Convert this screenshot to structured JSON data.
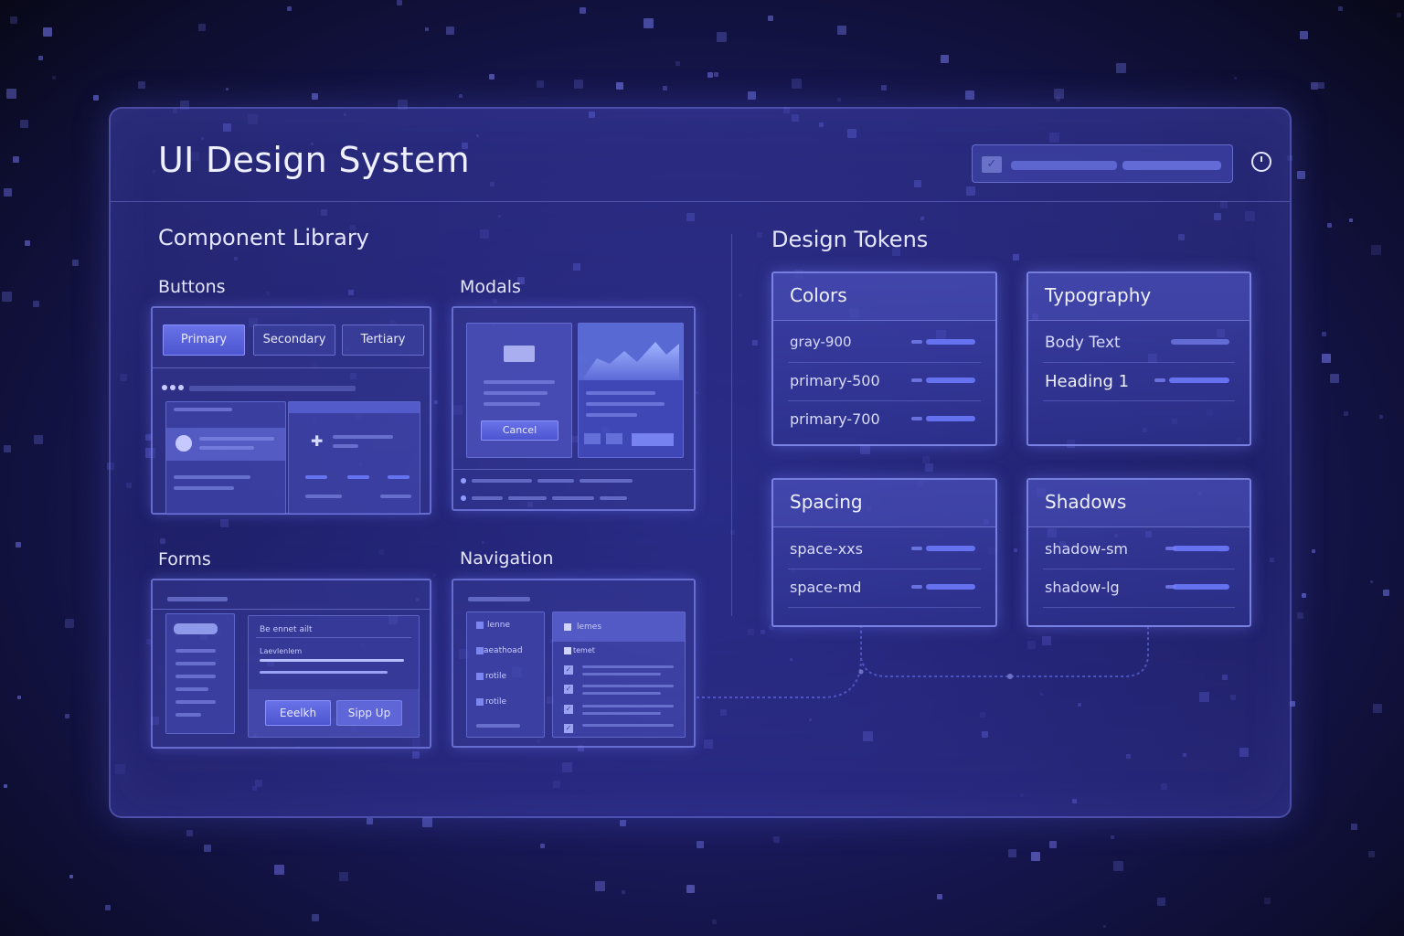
{
  "header": {
    "title": "UI Design System"
  },
  "component_library": {
    "title": "Component Library",
    "buttons": {
      "title": "Buttons",
      "labels": [
        "Primary",
        "Secondary",
        "Tertiary"
      ]
    },
    "modals": {
      "title": "Modals",
      "cancel_label": "Cancel"
    },
    "forms": {
      "title": "Forms",
      "field_label_1": "Be ennet ailt",
      "field_label_2": "Laevlenlem",
      "button_1": "Eeelkh",
      "button_2": "Sipp Up"
    },
    "navigation": {
      "title": "Navigation",
      "side_items": [
        "lenne",
        "aeathoad",
        "rotile",
        "rotile"
      ],
      "panel_header": "lemes",
      "panel_subheader": "temet"
    }
  },
  "design_tokens": {
    "title": "Design Tokens",
    "colors": {
      "title": "Colors",
      "items": [
        "gray-900",
        "primary-500",
        "primary-700"
      ]
    },
    "typography": {
      "title": "Typography",
      "items": [
        "Body Text",
        "Heading 1"
      ]
    },
    "spacing": {
      "title": "Spacing",
      "items": [
        "space-xxs",
        "space-md"
      ]
    },
    "shadows": {
      "title": "Shadows",
      "items": [
        "shadow-sm",
        "shadow-lg"
      ]
    }
  },
  "theme": {
    "accent": "#5a62e0",
    "background": "#12124a",
    "panel_border": "#8c96ff"
  },
  "icons": [
    "checkbox-icon",
    "power-icon",
    "clock-icon",
    "plus-icon",
    "chart-icon"
  ]
}
